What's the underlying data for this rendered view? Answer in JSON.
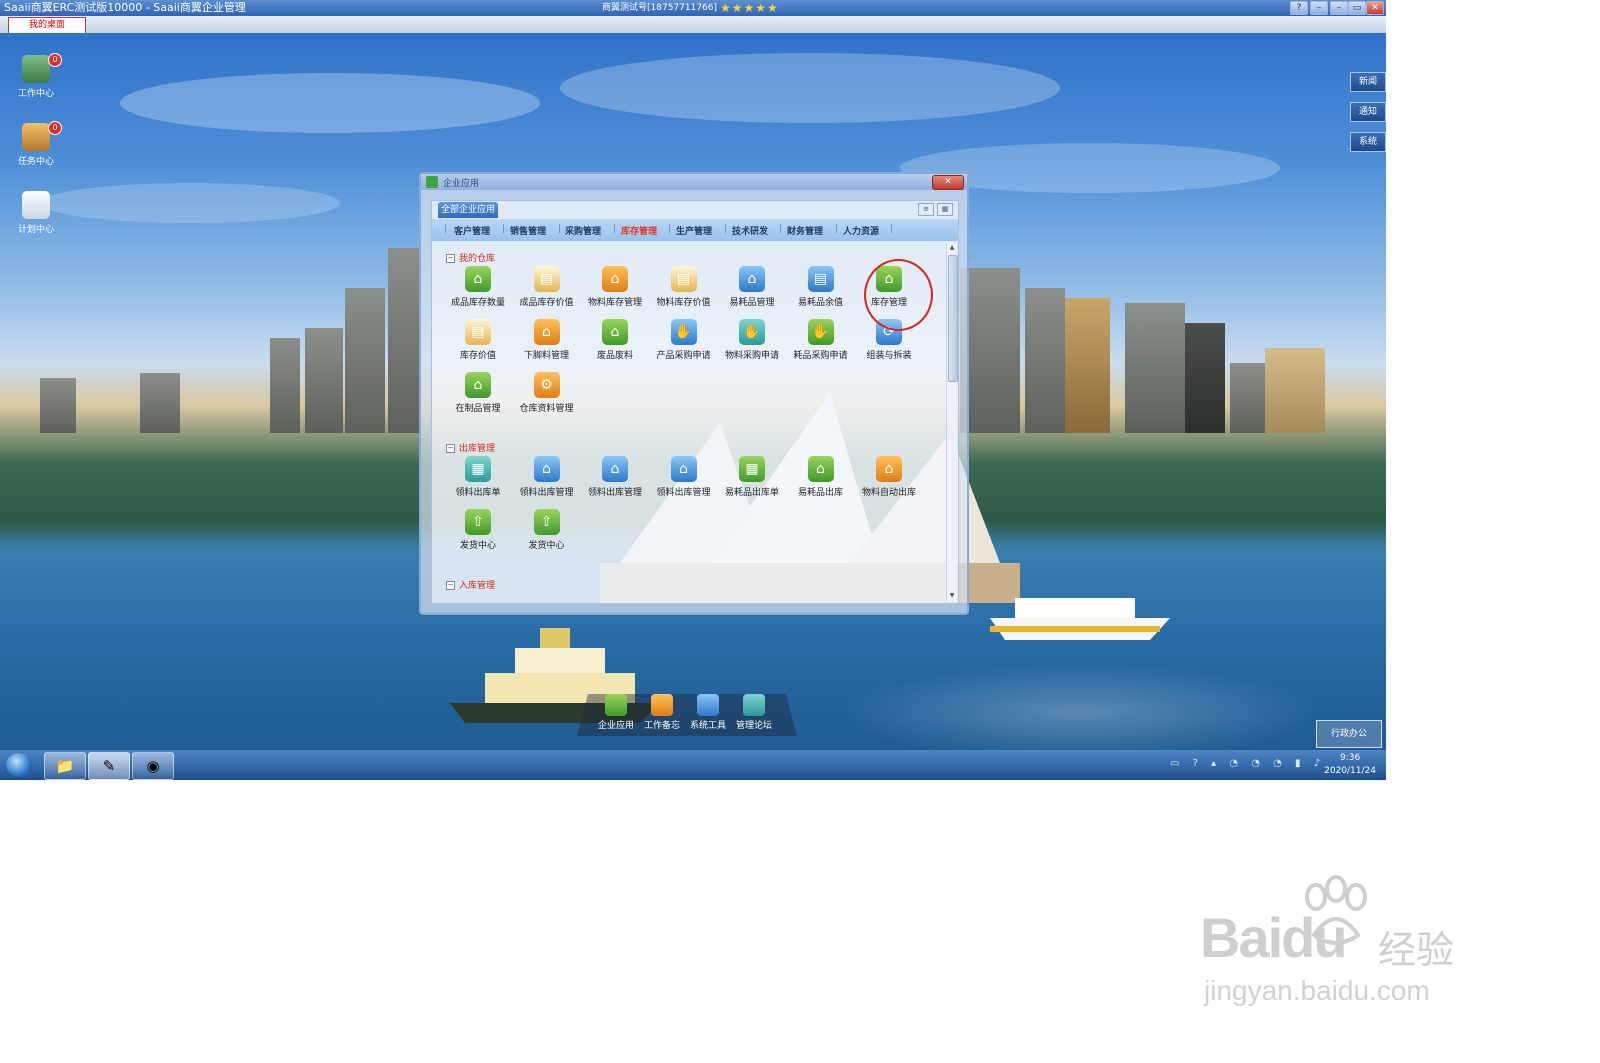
{
  "titlebar": {
    "app_title": "Saaii商翼ERC测试版10000 - Saaii商翼企业管理",
    "user_info": "商翼测试号[18757711766]",
    "stars": "★★★★★",
    "minimize": "–",
    "restore": "▭",
    "close": "✕",
    "help": "?"
  },
  "desktop_tab": {
    "label": "我的桌面"
  },
  "desktop_icons": [
    {
      "label": "工作中心",
      "badge": "0"
    },
    {
      "label": "任务中心",
      "badge": "0"
    },
    {
      "label": "计划中心"
    }
  ],
  "right_buttons": [
    "新闻",
    "通知",
    "系统"
  ],
  "window": {
    "title": "企业应用",
    "close": "✕",
    "tab": "全部企业应用",
    "categories": [
      "客户管理",
      "销售管理",
      "采购管理",
      "库存管理",
      "生产管理",
      "技术研发",
      "财务管理",
      "人力资源"
    ],
    "active_category": "库存管理",
    "sections": [
      {
        "title": "我的仓库",
        "items": [
          {
            "label": "成品库存数量",
            "color": "g-green",
            "icon": "house-icon"
          },
          {
            "label": "成品库存价值",
            "color": "g-doc",
            "icon": "document-icon"
          },
          {
            "label": "物料库存管理",
            "color": "g-orange",
            "icon": "house-icon"
          },
          {
            "label": "物料库存价值",
            "color": "g-doc",
            "icon": "document-icon"
          },
          {
            "label": "易耗品管理",
            "color": "g-blue",
            "icon": "house-icon"
          },
          {
            "label": "易耗品余值",
            "color": "g-blue",
            "icon": "document-icon"
          },
          {
            "label": "库存管理",
            "color": "g-green",
            "icon": "house-icon"
          },
          {
            "label": "库存价值",
            "color": "g-doc",
            "icon": "document-icon"
          },
          {
            "label": "下脚料管理",
            "color": "g-orange",
            "icon": "house-icon"
          },
          {
            "label": "废品废料",
            "color": "g-green",
            "icon": "house-icon"
          },
          {
            "label": "产品采购申请",
            "color": "g-blue",
            "icon": "hand-icon"
          },
          {
            "label": "物料采购申请",
            "color": "g-teal",
            "icon": "hand-icon"
          },
          {
            "label": "耗品采购申请",
            "color": "g-green",
            "icon": "hand-icon"
          },
          {
            "label": "组装与拆装",
            "color": "g-blue",
            "icon": "refresh-icon"
          },
          {
            "label": "在制品管理",
            "color": "g-green",
            "icon": "house-icon"
          },
          {
            "label": "仓库资料管理",
            "color": "g-orange",
            "icon": "gear-icon"
          }
        ]
      },
      {
        "title": "出库管理",
        "items": [
          {
            "label": "领料出库单",
            "color": "g-teal",
            "icon": "calendar-icon"
          },
          {
            "label": "领料出库管理",
            "color": "g-blue",
            "icon": "house-icon"
          },
          {
            "label": "领料出库管理",
            "color": "g-blue",
            "icon": "house-icon"
          },
          {
            "label": "领料出库管理",
            "color": "g-blue",
            "icon": "house-icon"
          },
          {
            "label": "易耗品出库单",
            "color": "g-green",
            "icon": "calendar-icon"
          },
          {
            "label": "易耗品出库",
            "color": "g-green",
            "icon": "house-icon"
          },
          {
            "label": "物料自动出库",
            "color": "g-orange",
            "icon": "house-icon"
          },
          {
            "label": "发货中心",
            "color": "g-green",
            "icon": "upload-icon"
          },
          {
            "label": "发货中心",
            "color": "g-green",
            "icon": "upload-icon"
          }
        ]
      },
      {
        "title": "入库管理",
        "items": []
      }
    ]
  },
  "dock": [
    {
      "label": "企业应用",
      "color": "g-green"
    },
    {
      "label": "工作备忘",
      "color": "g-orange"
    },
    {
      "label": "系统工具",
      "color": "g-blue"
    },
    {
      "label": "管理论坛",
      "color": "g-teal"
    }
  ],
  "office_button": "行政办公",
  "taskbar": {
    "time": "9:36",
    "date": "2020/11/24"
  },
  "watermark": {
    "brand": "Baidu",
    "jingyan": "经验",
    "url": "jingyan.baidu.com"
  }
}
